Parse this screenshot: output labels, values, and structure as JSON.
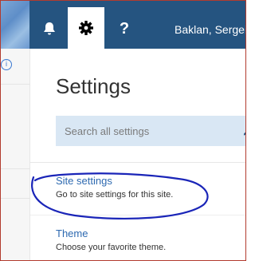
{
  "header": {
    "user_name": "Baklan, Sergei",
    "buttons": [
      {
        "icon": "bell-icon"
      },
      {
        "icon": "gear-icon"
      },
      {
        "label": "?"
      }
    ]
  },
  "left": {
    "info_icon_text": "i"
  },
  "settings": {
    "title": "Settings",
    "search_placeholder": "Search all settings",
    "items": [
      {
        "title": "Site settings",
        "description": "Go to site settings for this site."
      },
      {
        "title": "Theme",
        "description": "Choose your favorite theme."
      }
    ]
  },
  "colors": {
    "topbar": "#255480",
    "link": "#2d69b0",
    "search_bg": "#d9e7f4",
    "annotation": "#1a25b8"
  }
}
